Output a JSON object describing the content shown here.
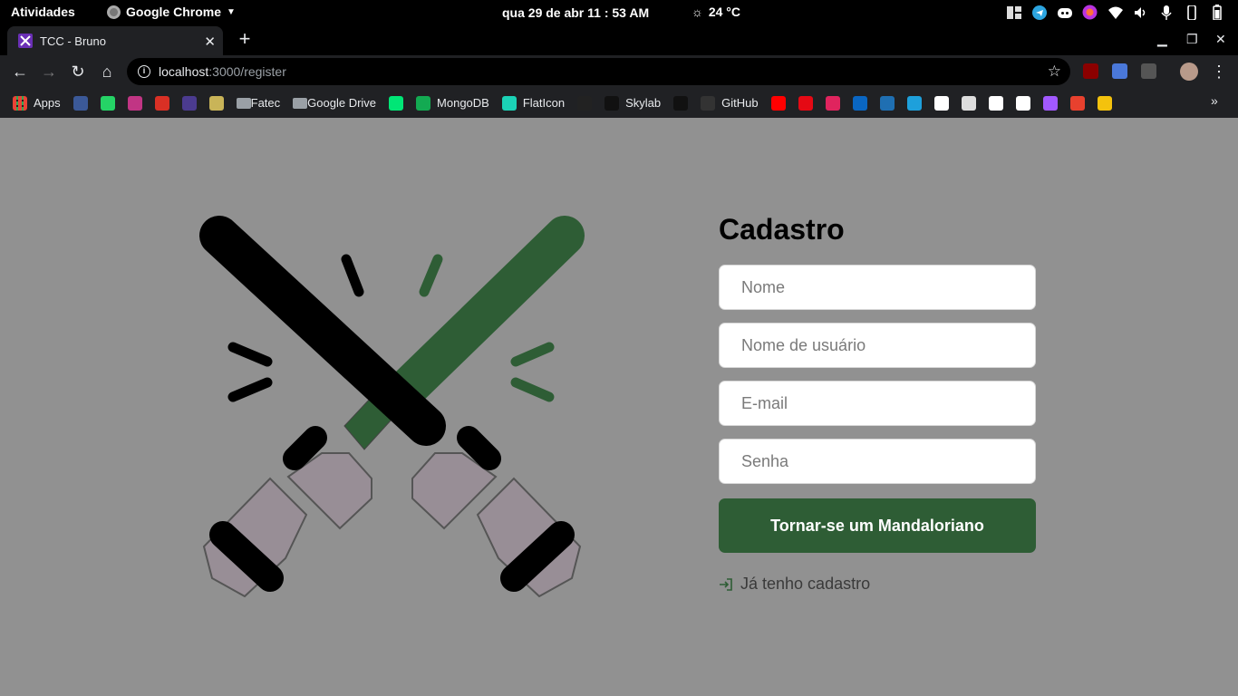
{
  "system": {
    "activities": "Atividades",
    "app_name": "Google Chrome",
    "clock": "qua 29 de abr  11 : 53 AM",
    "weather": "24 °C"
  },
  "browser": {
    "tab_title": "TCC - Bruno",
    "url_host": "localhost",
    "url_path": ":3000/register",
    "bookmarks": [
      {
        "label": "Apps",
        "icon": "apps-grid-icon"
      },
      {
        "label": "",
        "icon": "facebook-icon",
        "color": "#3b5998"
      },
      {
        "label": "",
        "icon": "whatsapp-icon",
        "color": "#25d366"
      },
      {
        "label": "",
        "icon": "instagram-icon",
        "color": "#c13584"
      },
      {
        "label": "",
        "icon": "gmail-icon",
        "color": "#d93025"
      },
      {
        "label": "",
        "icon": "bookmark-app-icon",
        "color": "#4b3b8f"
      },
      {
        "label": "",
        "icon": "bookmark-cloud-icon",
        "color": "#c9b458"
      },
      {
        "label": "Fatec",
        "icon": "folder-icon"
      },
      {
        "label": "Google Drive",
        "icon": "folder-icon"
      },
      {
        "label": "",
        "icon": "bookmark-green-icon",
        "color": "#00e676"
      },
      {
        "label": "MongoDB",
        "icon": "mongodb-icon",
        "color": "#13aa52"
      },
      {
        "label": "FlatIcon",
        "icon": "flaticon-icon",
        "color": "#1bd2b6"
      },
      {
        "label": "",
        "icon": "k-icon",
        "color": "#222"
      },
      {
        "label": "Skylab",
        "icon": "skylab-icon",
        "color": "#111"
      },
      {
        "label": "",
        "icon": "d-icon",
        "color": "#111"
      },
      {
        "label": "GitHub",
        "icon": "github-icon",
        "color": "#333"
      },
      {
        "label": "",
        "icon": "youtube-icon",
        "color": "#ff0000"
      },
      {
        "label": "",
        "icon": "netflix-icon",
        "color": "#e50914"
      },
      {
        "label": "",
        "icon": "udemy-icon",
        "color": "#e0245e"
      },
      {
        "label": "",
        "icon": "linkedin-icon",
        "color": "#0a66c2"
      },
      {
        "label": "",
        "icon": "amazon-icon",
        "color": "#1f6fb2"
      },
      {
        "label": "",
        "icon": "link-icon",
        "color": "#1ea0db"
      },
      {
        "label": "",
        "icon": "linux-icon",
        "color": "#fff"
      },
      {
        "label": "",
        "icon": "grid-app-icon",
        "color": "#ddd"
      },
      {
        "label": "",
        "icon": "google-icon",
        "color": "#fff"
      },
      {
        "label": "",
        "icon": "chess-icon",
        "color": "#fff"
      },
      {
        "label": "",
        "icon": "figma-icon",
        "color": "#a259ff"
      },
      {
        "label": "",
        "icon": "fire-icon",
        "color": "#e8412e"
      },
      {
        "label": "",
        "icon": "w-icon",
        "color": "#f4c20d"
      }
    ]
  },
  "register": {
    "title": "Cadastro",
    "name_placeholder": "Nome",
    "username_placeholder": "Nome de usuário",
    "email_placeholder": "E-mail",
    "password_placeholder": "Senha",
    "submit_label": "Tornar-se um Mandaloriano",
    "login_link": "Já tenho cadastro"
  },
  "colors": {
    "accent": "#2e5d35",
    "background": "#919191"
  }
}
